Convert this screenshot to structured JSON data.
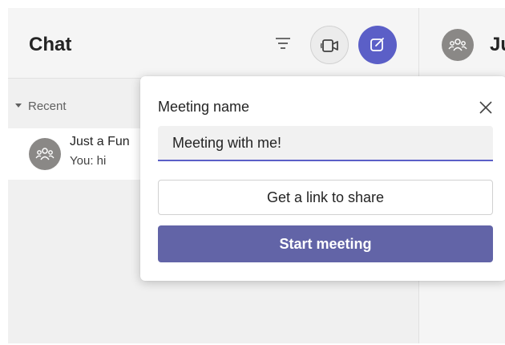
{
  "chat_panel": {
    "title": "Chat",
    "filter_icon": "filter-icon",
    "meet_now_icon": "video-camera-icon",
    "new_chat_icon": "compose-icon",
    "recent_label": "Recent",
    "item": {
      "name": "Just a Fun",
      "preview": "You: hi",
      "avatar_icon": "group-icon"
    }
  },
  "conversation": {
    "title_fragment": "Ju",
    "avatar_icon": "group-icon"
  },
  "meeting_popup": {
    "label": "Meeting name",
    "input_value": "Meeting with me!",
    "link_button": "Get a link to share",
    "start_button": "Start meeting",
    "close_icon": "close-icon"
  },
  "colors": {
    "brand": "#6264a7",
    "accent": "#5b5fc7",
    "avatar": "#8a8886"
  }
}
